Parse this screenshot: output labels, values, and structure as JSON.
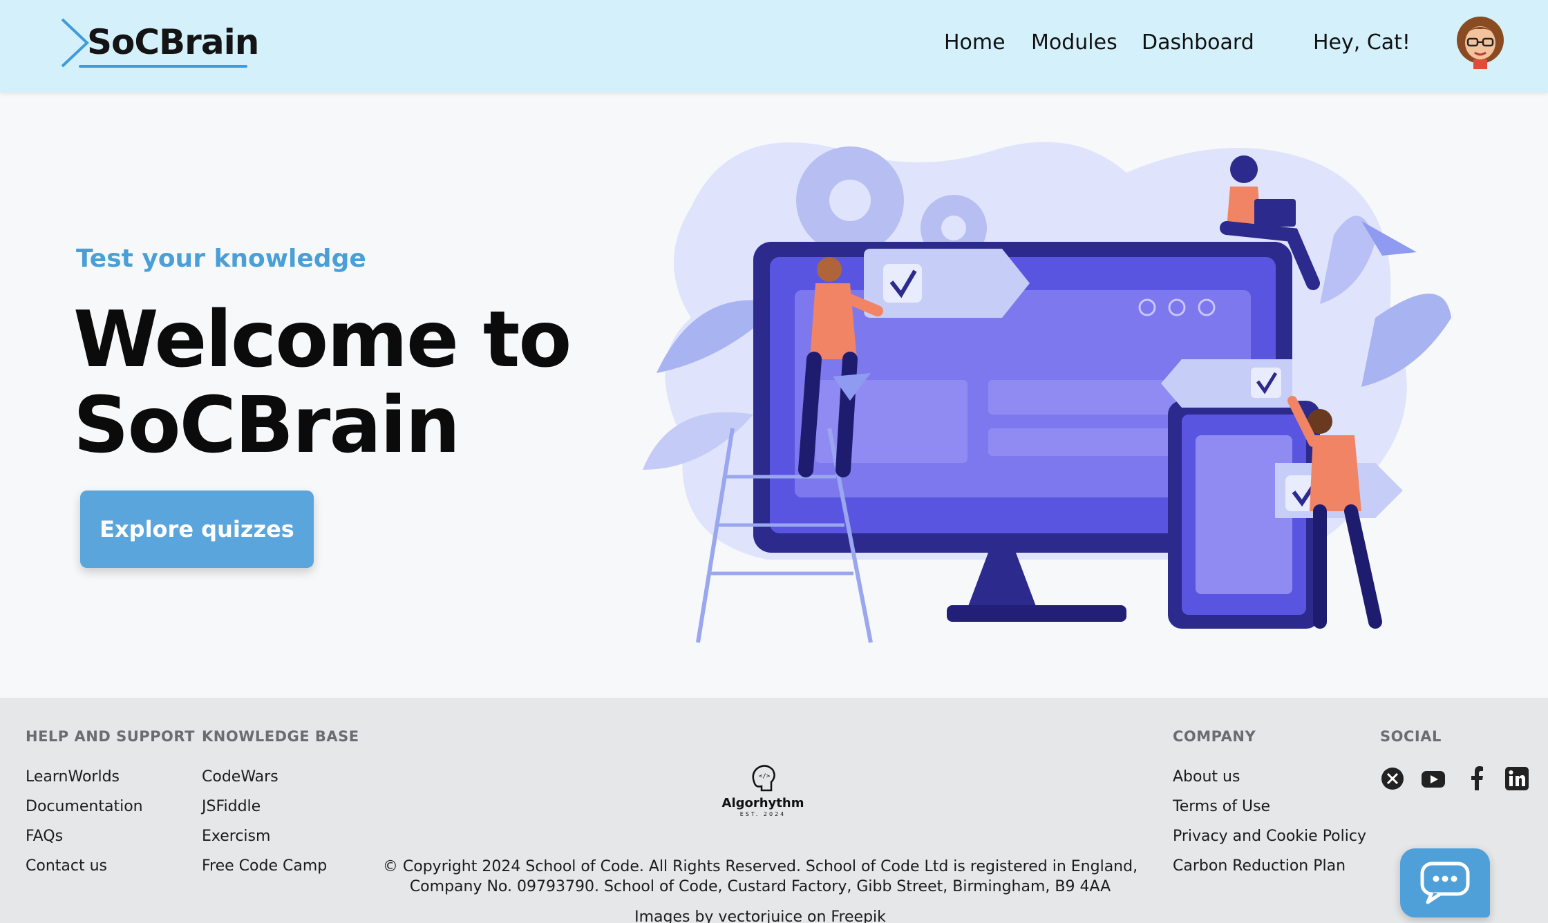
{
  "header": {
    "logo_text": "SoCBrain",
    "nav": {
      "home": "Home",
      "modules": "Modules",
      "dashboard": "Dashboard"
    },
    "greeting": "Hey, Cat!"
  },
  "hero": {
    "subtitle": "Test your knowledge",
    "title": "Welcome to SoCBrain",
    "cta": "Explore quizzes"
  },
  "footer": {
    "help": {
      "heading": "HELP AND SUPPORT",
      "links": [
        "LearnWorlds",
        "Documentation",
        "FAQs",
        "Contact us"
      ]
    },
    "knowledge": {
      "heading": "KNOWLEDGE BASE",
      "links": [
        "CodeWars",
        "JSFiddle",
        "Exercism",
        "Free Code Camp"
      ]
    },
    "brand": {
      "name": "Algorhythm",
      "est": "EST. 2024"
    },
    "copyright": "© Copyright 2024 School of Code. All Rights Reserved. School of Code Ltd is registered in England, Company No. 09793790. School of Code, Custard Factory, Gibb Street, Birmingham, B9 4AA",
    "credit": "Images by vectorjuice on Freepik",
    "company": {
      "heading": "COMPANY",
      "links": [
        "About us",
        "Terms of Use",
        "Privacy and Cookie Policy",
        "Carbon Reduction Plan"
      ]
    },
    "social": {
      "heading": "SOCIAL",
      "icons": [
        "x-icon",
        "youtube-icon",
        "facebook-icon",
        "linkedin-icon"
      ]
    }
  },
  "colors": {
    "header_bg": "#d4f1fb",
    "accent": "#4a9fd7",
    "cta_bg": "#5aa5dc",
    "footer_bg": "#e5e7e8",
    "illustration_primary": "#4a45d6"
  }
}
